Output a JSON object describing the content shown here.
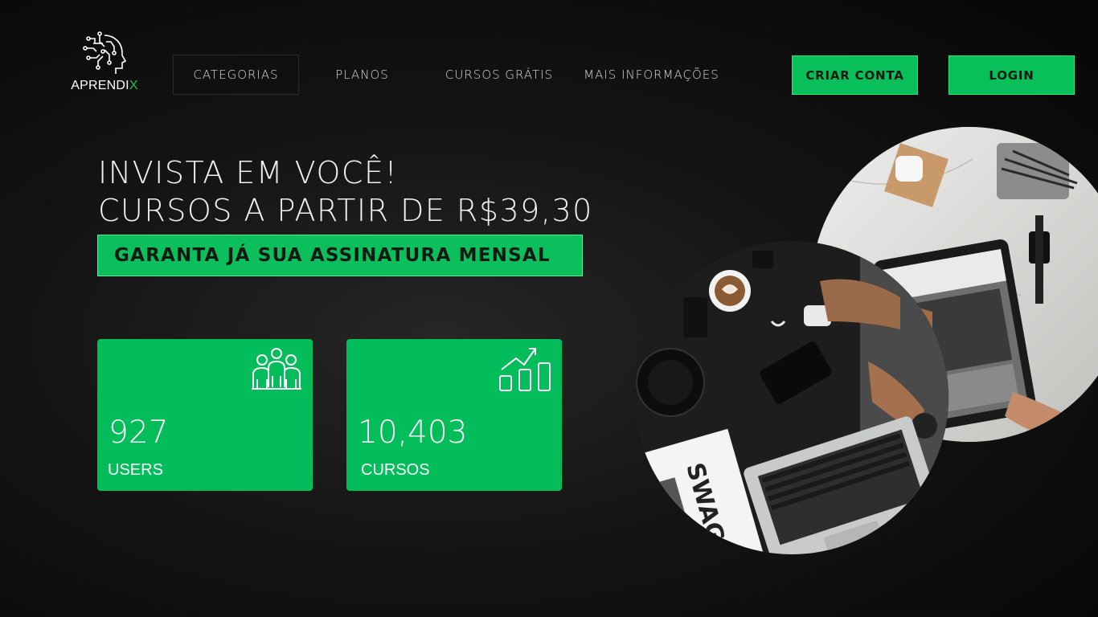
{
  "brand": {
    "name_main": "APRENDI",
    "name_accent": "X"
  },
  "nav": {
    "items": [
      {
        "label": "CATEGORIAS"
      },
      {
        "label": "PLANOS"
      },
      {
        "label": "CURSOS GRÁTIS"
      },
      {
        "label": "MAIS INFORMAÇÕES"
      }
    ]
  },
  "actions": {
    "signup_label": "CRIAR CONTA",
    "login_label": "LOGIN"
  },
  "hero": {
    "line1": "INVISTA EM VOCÊ!",
    "line2": "CURSOS A PARTIR DE R$39,30",
    "cta_label": "GARANTA JÁ SUA ASSINATURA MENSAL"
  },
  "stats": [
    {
      "value": "927",
      "label": "USERS",
      "icon": "users-group-icon"
    },
    {
      "value": "10,403",
      "label": "CURSOS",
      "icon": "growth-chart-icon"
    }
  ],
  "colors": {
    "accent": "#03bd5b",
    "background": "#141414"
  }
}
